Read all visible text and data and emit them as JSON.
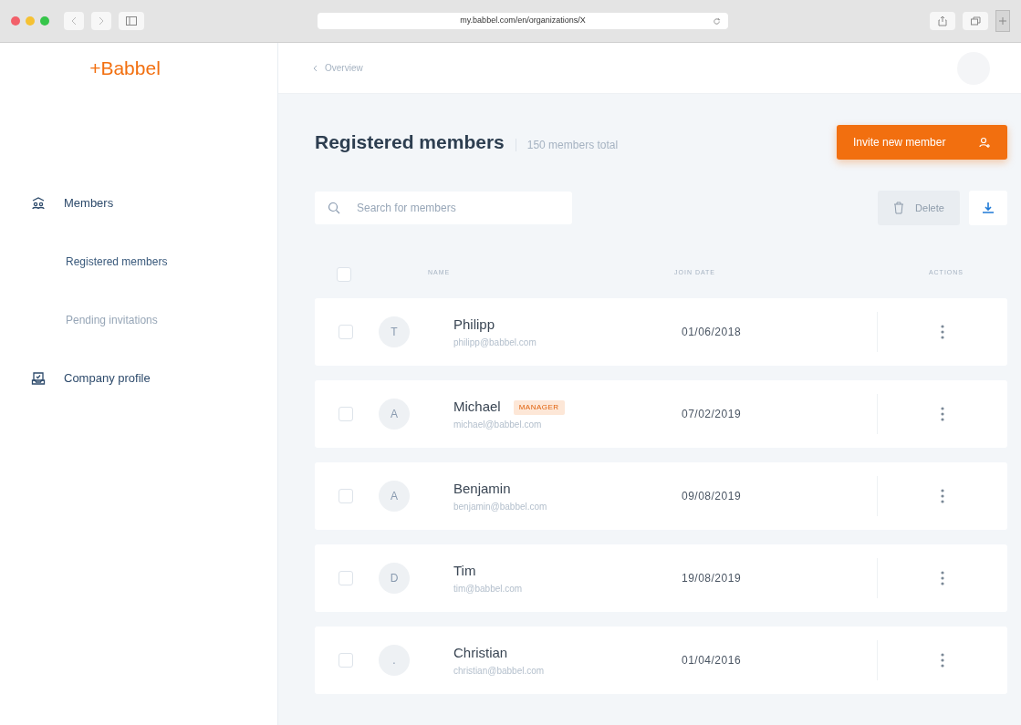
{
  "browser": {
    "url": "my.babbel.com/en/organizations/X"
  },
  "sidebar": {
    "logo": "+Babbel",
    "items": [
      {
        "kind": "section",
        "label": "Members",
        "selected": false
      },
      {
        "kind": "sub",
        "label": "Registered members",
        "selected": true
      },
      {
        "kind": "sub",
        "label": "Pending invitations",
        "selected": false
      },
      {
        "kind": "section",
        "label": "Company profile",
        "selected": false
      }
    ]
  },
  "header": {
    "back_link": "Overview"
  },
  "page": {
    "title": "Registered members",
    "count": "150 members total",
    "invite_button": "Invite new member",
    "search": {
      "placeholder": "Search for members"
    },
    "delete_button": {
      "label": "Delete",
      "disabled": true
    }
  },
  "table": {
    "select_all": {
      "checked": false
    },
    "columns": [
      "NAME",
      "JOIN DATE",
      "ACTIONS"
    ],
    "rows": [
      {
        "checked": false,
        "avatar": "T",
        "name": "Philipp",
        "email": "philipp@babbel.com",
        "join_date": "01/06/2018"
      },
      {
        "checked": false,
        "avatar": "A",
        "name": "Michael",
        "badge": "MANAGER",
        "email": "michael@babbel.com",
        "join_date": "07/02/2019"
      },
      {
        "checked": false,
        "avatar": "A",
        "name": "Benjamin",
        "email": "benjamin@babbel.com",
        "join_date": "09/08/2019"
      },
      {
        "checked": false,
        "avatar": "D",
        "name": "Tim",
        "email": "tim@babbel.com",
        "join_date": "19/08/2019"
      },
      {
        "checked": false,
        "avatar": ".",
        "name": "Christian",
        "email": "christian@babbel.com",
        "join_date": "01/04/2016"
      }
    ]
  }
}
